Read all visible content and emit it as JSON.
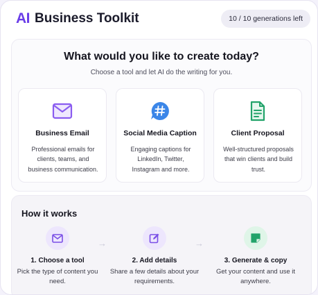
{
  "header": {
    "logo_ai": "AI",
    "logo_name": "Business Toolkit",
    "generations_badge": "10 / 10 generations left"
  },
  "main": {
    "title": "What would you like to create today?",
    "subtitle": "Choose a tool and let AI do the writing for you.",
    "cards": [
      {
        "title": "Business Email",
        "desc": "Professional emails for clients, teams, and business communication.",
        "icon": "mail-icon"
      },
      {
        "title": "Social Media Caption",
        "desc": "Engaging captions for LinkedIn, Twitter, Instagram and more.",
        "icon": "hashtag-icon"
      },
      {
        "title": "Client Proposal",
        "desc": "Well-structured proposals that win clients and build trust.",
        "icon": "document-icon"
      }
    ]
  },
  "how": {
    "title": "How it works",
    "arrow": "→",
    "steps": [
      {
        "title": "1. Choose a tool",
        "desc": "Pick the type of content you need.",
        "icon": "mail-icon"
      },
      {
        "title": "2. Add details",
        "desc": "Share a few details about your requirements.",
        "icon": "edit-icon"
      },
      {
        "title": "3. Generate & copy",
        "desc": "Get your content and use it anywhere.",
        "icon": "copy-icon"
      }
    ]
  },
  "colors": {
    "accent": "#6a3de8",
    "mail_icon": "#8a5cf0",
    "hashtag_icon": "#3b86e8",
    "document_icon": "#22a36a"
  }
}
